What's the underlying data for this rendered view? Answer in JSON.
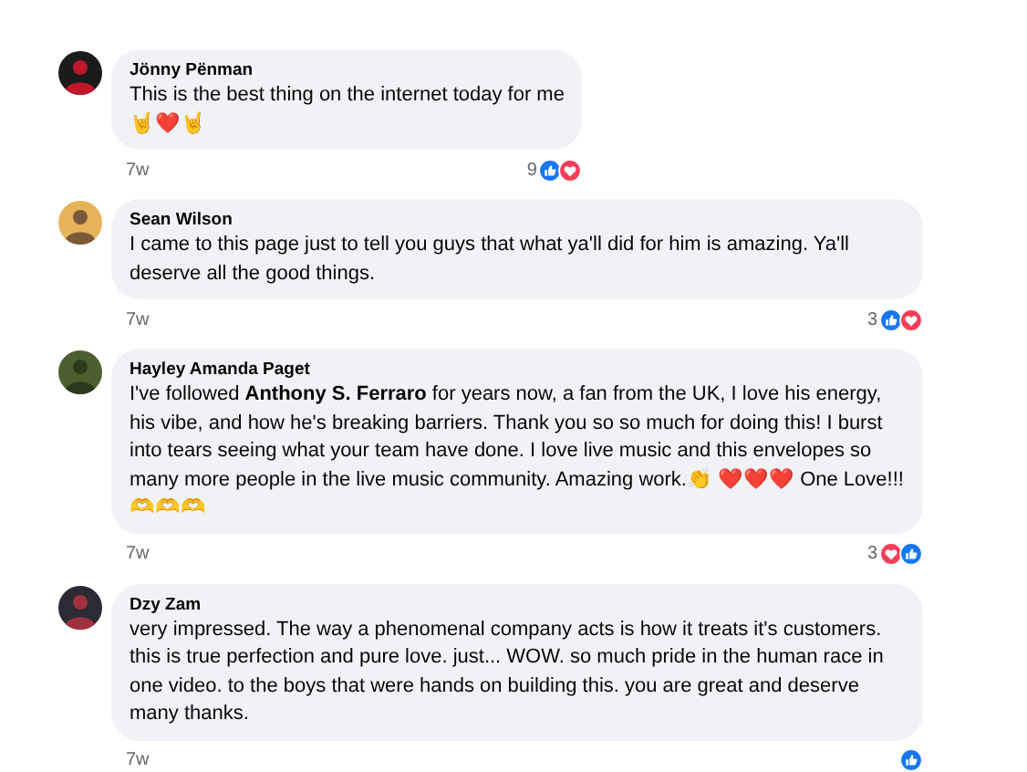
{
  "comments": [
    {
      "author": "Jönny Pënman",
      "text": "This is the best thing on the internet today for me",
      "extra": "🤘❤️🤘",
      "time": "7w",
      "reaction_count": "9",
      "reactions": [
        {
          "kind": "like"
        },
        {
          "kind": "love"
        }
      ]
    },
    {
      "author": "Sean Wilson",
      "text": "I came to this page just to tell you guys that what ya'll did for him is amazing. Ya'll deserve all the good things.",
      "time": "7w",
      "reaction_count": "3",
      "reactions": [
        {
          "kind": "like"
        },
        {
          "kind": "love"
        }
      ]
    },
    {
      "author": "Hayley Amanda Paget",
      "text": "I've followed **Anthony S. Ferraro** for years now, a fan from the UK, I love his energy, his vibe, and how he's breaking barriers. Thank you so so much for doing this! I burst into tears seeing what your team have done. I love live music and this envelopes so many more people in the live music community. Amazing work.👏 ❤️❤️❤️ One Love!!! 🫶🫶🫶",
      "time": "7w",
      "reaction_count": "3",
      "reactions": [
        {
          "kind": "love"
        },
        {
          "kind": "like"
        }
      ]
    },
    {
      "author": "Dzy Zam",
      "text": "very impressed. The way a phenomenal company acts is how it treats it's customers. this is true perfection and pure love. just... WOW. so much pride in the human race in one video. to the boys that were hands on building this. you are great and deserve many thanks.",
      "time": "7w",
      "reactions": [
        {
          "kind": "like"
        }
      ]
    }
  ]
}
